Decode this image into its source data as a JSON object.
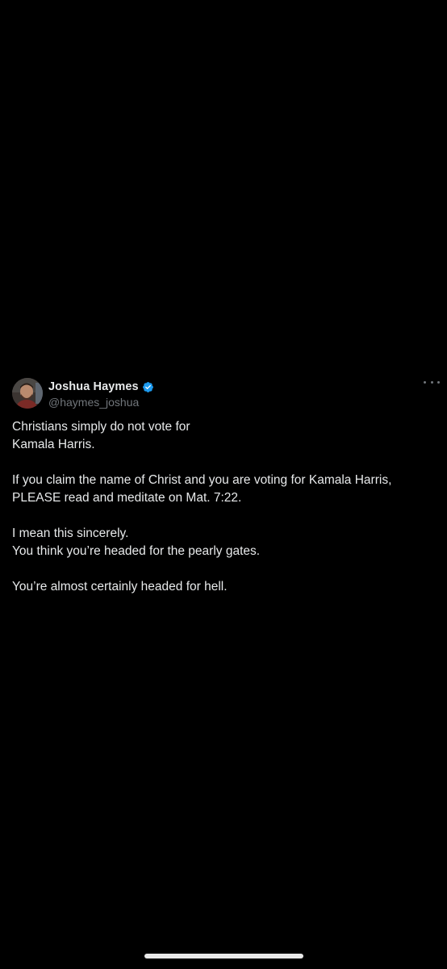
{
  "tweet": {
    "author": {
      "display_name": "Joshua Haymes",
      "handle": "@haymes_joshua",
      "verified": true,
      "verified_color": "#1d9bf0"
    },
    "paragraphs": [
      [
        "Christians simply do not vote for",
        "Kamala Harris."
      ],
      [
        "If you claim the name of Christ and you are voting for Kamala Harris,",
        "PLEASE read and meditate on Mat. 7:22."
      ],
      [
        "I mean this sincerely.",
        "You think you’re headed for the pearly gates."
      ],
      [
        "You’re almost certainly headed for hell."
      ]
    ],
    "more_icon": "more-horizontal-icon"
  },
  "theme": {
    "background": "#000000",
    "text": "#e7e9ea",
    "secondary_text": "#71767b"
  }
}
